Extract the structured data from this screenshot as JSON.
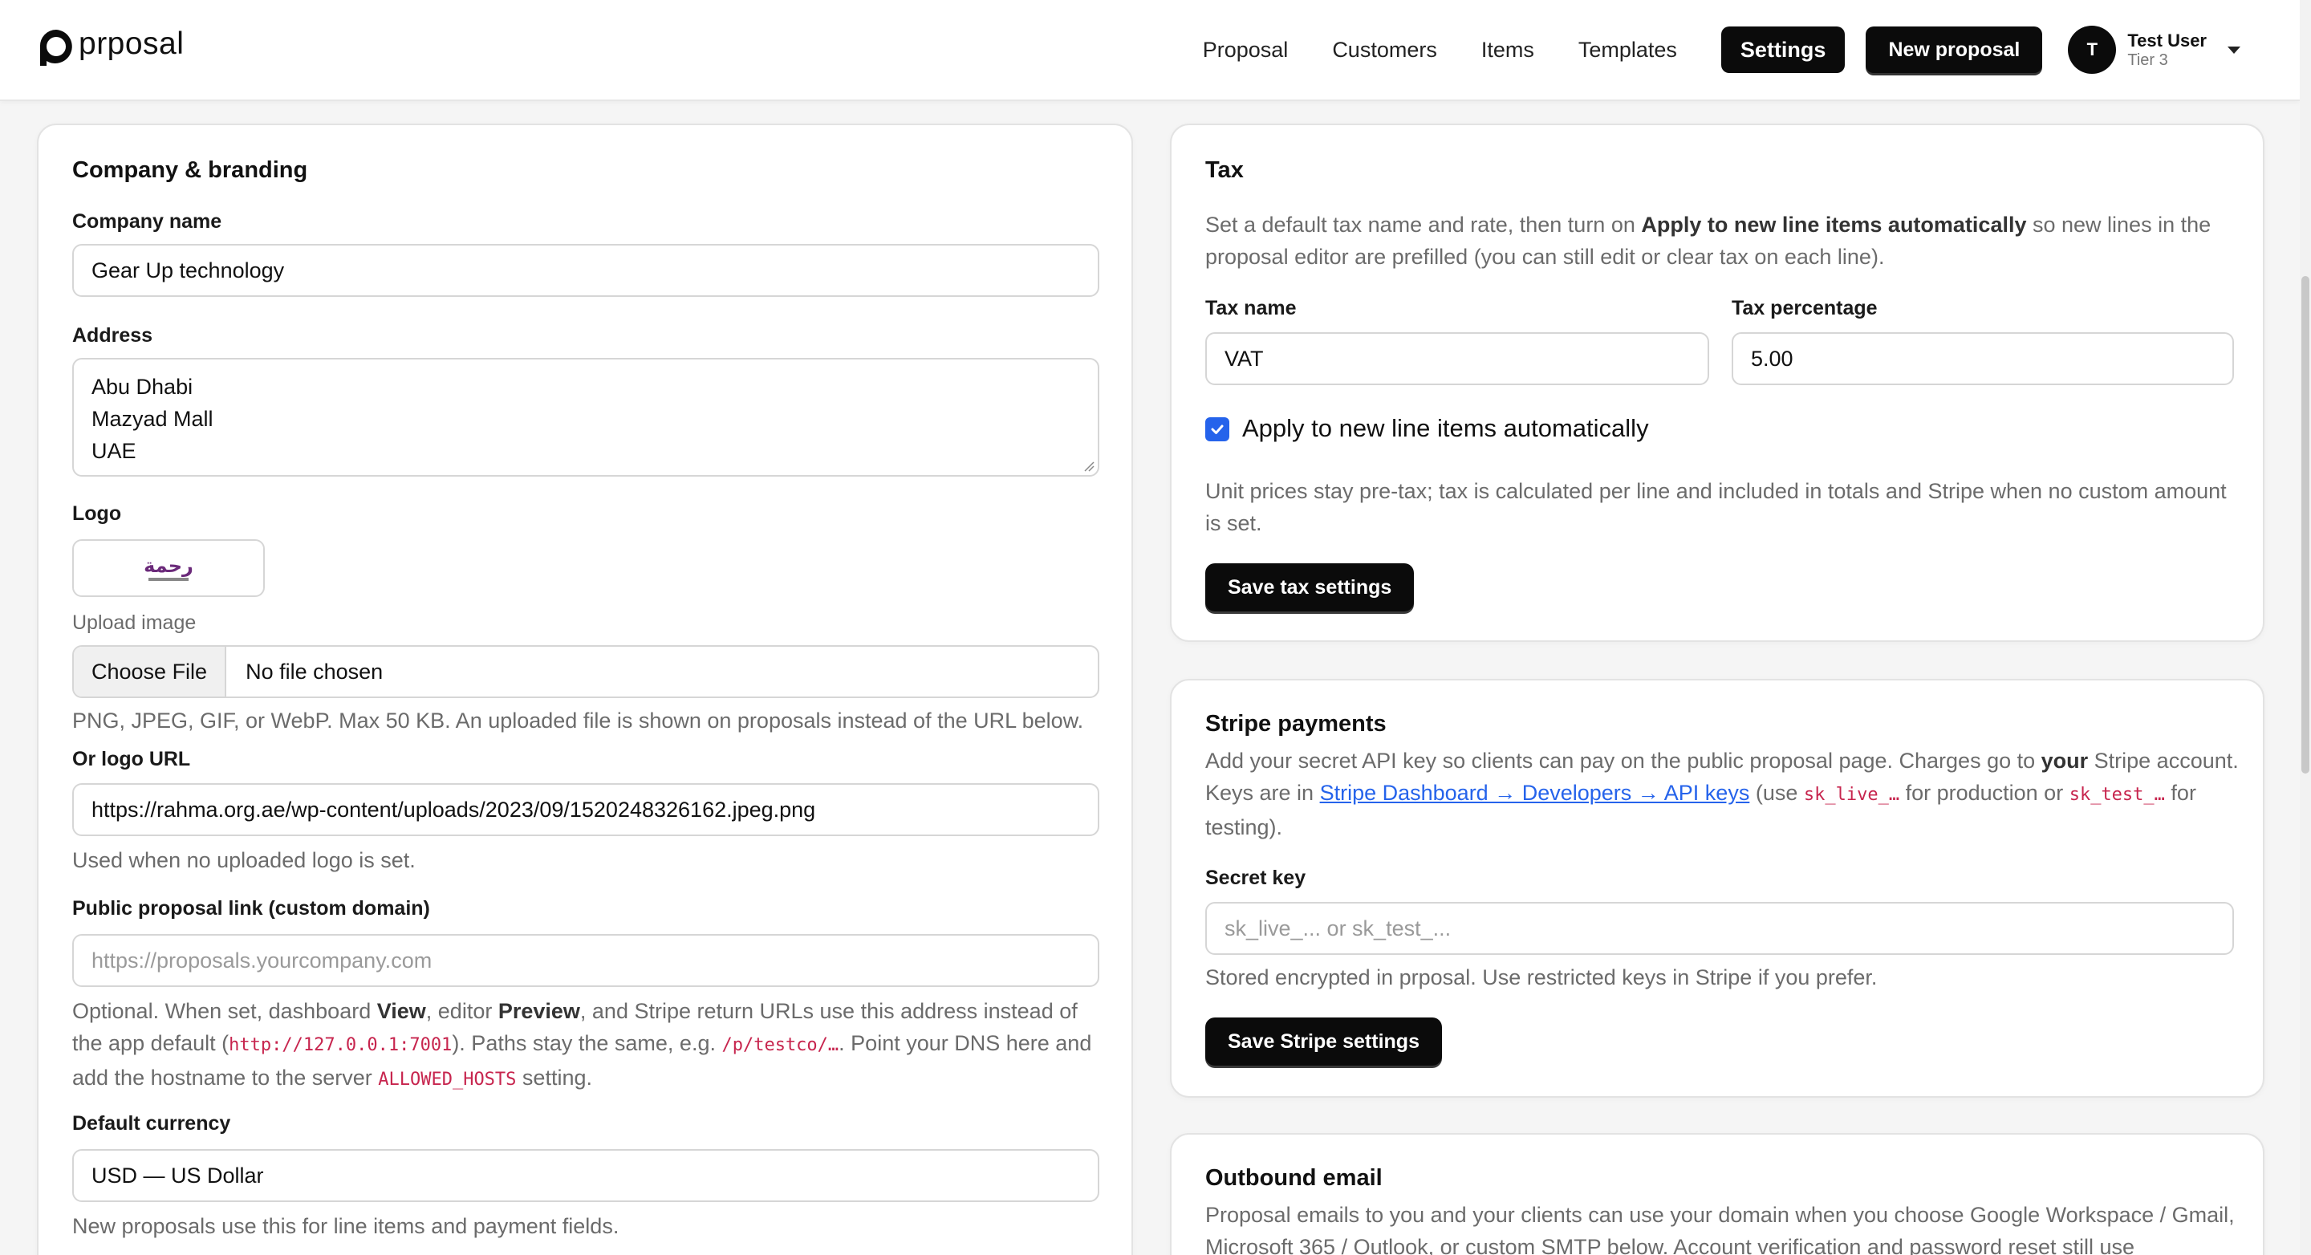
{
  "brand": {
    "name": "prposal"
  },
  "nav": {
    "links": [
      "Proposal",
      "Customers",
      "Items",
      "Templates"
    ],
    "settings_label": "Settings",
    "new_proposal_label": "New proposal"
  },
  "user": {
    "initial": "T",
    "name": "Test User",
    "tier": "Tier 3"
  },
  "company": {
    "title": "Company & branding",
    "company_name_label": "Company name",
    "company_name_value": "Gear Up technology",
    "address_label": "Address",
    "address_lines": [
      "Abu Dhabi",
      "Mazyad Mall",
      "UAE"
    ],
    "logo_label": "Logo",
    "logo_text": "رحمة",
    "upload_label": "Upload image",
    "choose_file": "Choose File",
    "no_file": "No file chosen",
    "upload_help": "PNG, JPEG, GIF, or WebP. Max 50 KB. An uploaded file is shown on proposals instead of the URL below.",
    "logo_url_label": "Or logo URL",
    "logo_url_value": "https://rahma.org.ae/wp-content/uploads/2023/09/1520248326162.jpeg.png",
    "logo_url_help": "Used when no uploaded logo is set.",
    "public_link_label": "Public proposal link (custom domain)",
    "public_link_placeholder": "https://proposals.yourcompany.com",
    "public_help_1": "Optional. When set, dashboard ",
    "public_help_view": "View",
    "public_help_2": ", editor ",
    "public_help_preview": "Preview",
    "public_help_3": ", and Stripe return URLs use this address instead of the app default (",
    "public_help_code1": "http://127.0.0.1:7001",
    "public_help_4": "). Paths stay the same, e.g. ",
    "public_help_code2": "/p/testco/…",
    "public_help_5": ". Point your DNS here and add the hostname to the server ",
    "public_help_code3": "ALLOWED_HOSTS",
    "public_help_6": " setting.",
    "currency_label": "Default currency",
    "currency_value": "USD — US Dollar",
    "currency_help": "New proposals use this for line items and payment fields."
  },
  "tax": {
    "title": "Tax",
    "intro_1": "Set a default tax name and rate, then turn on ",
    "intro_bold": "Apply to new line items automatically",
    "intro_2": " so new lines in the proposal editor are prefilled (you can still edit or clear tax on each line).",
    "name_label": "Tax name",
    "name_value": "VAT",
    "pct_label": "Tax percentage",
    "pct_value": "5.00",
    "apply_label": "Apply to new line items automatically",
    "apply_checked": true,
    "note": "Unit prices stay pre-tax; tax is calculated per line and included in totals and Stripe when no custom amount is set.",
    "save_label": "Save tax settings"
  },
  "stripe": {
    "title": "Stripe payments",
    "intro_1": "Add your secret API key so clients can pay on the public proposal page. Charges go to ",
    "intro_bold": "your",
    "intro_2": " Stripe account. Keys are in ",
    "intro_link": "Stripe Dashboard → Developers → API keys",
    "intro_3": " (use ",
    "intro_code1": "sk_live_…",
    "intro_4": " for production or ",
    "intro_code2": "sk_test_…",
    "intro_5": " for testing).",
    "secret_label": "Secret key",
    "secret_placeholder": "sk_live_... or sk_test_...",
    "secret_help": "Stored encrypted in prposal. Use restricted keys in Stripe if you prefer.",
    "save_label": "Save Stripe settings"
  },
  "email": {
    "title": "Outbound email",
    "intro": "Proposal emails to you and your clients can use your domain when you choose Google Workspace / Gmail, Microsoft 365 / Outlook, or custom SMTP below. Account verification and password reset still use"
  },
  "colors": {
    "accent": "#2563eb",
    "dark": "#0b0b0b",
    "code": "#c7254e"
  }
}
